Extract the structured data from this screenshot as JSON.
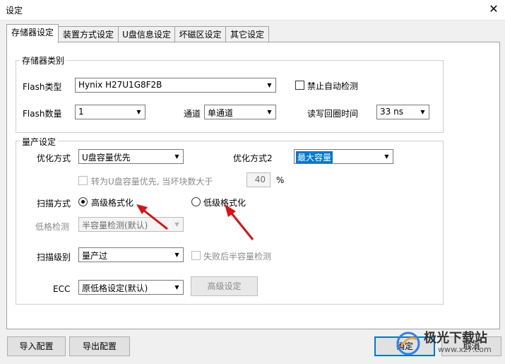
{
  "window": {
    "title": "设定"
  },
  "tabs": [
    {
      "label": "存储器设定",
      "active": true
    },
    {
      "label": "装置方式设定",
      "active": false
    },
    {
      "label": "U盘信息设定",
      "active": false
    },
    {
      "label": "坏磁区设定",
      "active": false
    },
    {
      "label": "其它设定",
      "active": false
    }
  ],
  "storage": {
    "group_title": "存储器类别",
    "flash_type_label": "Flash类型",
    "flash_type_value": "Hynix H27U1G8F2B",
    "disable_auto_detect_label": "禁止自动检测",
    "flash_count_label": "Flash数量",
    "flash_count_value": "1",
    "channel_label": "通道",
    "channel_value": "单通道",
    "rw_timing_label": "读写回圈时间",
    "rw_timing_value": "33 ns"
  },
  "production": {
    "group_title": "量产设定",
    "opt_mode_label": "优化方式",
    "opt_mode_value": "U盘容量优先",
    "opt_mode2_label": "优化方式2",
    "opt_mode2_value": "最大容量",
    "convert_label": "转为U盘容量优先, 当坏块数大于",
    "convert_value": "40",
    "percent": "%",
    "scan_method_label": "扫描方式",
    "high_format_label": "高级格式化",
    "low_format_label": "低级格式化",
    "low_check_label": "低格检测",
    "low_check_value": "半容量检测(默认)",
    "scan_level_label": "扫描级别",
    "scan_level_value": "量产过",
    "half_cap_label": "失败后半容量检测",
    "ecc_label": "ECC",
    "ecc_value": "原低格设定(默认)",
    "advanced_button": "高级设定"
  },
  "footer": {
    "import_button": "导入配置",
    "export_button": "导出配置",
    "ok_button": "确定",
    "cancel_button": "取消"
  },
  "watermark": {
    "text": "极光下载站",
    "url": "www.xz7.com"
  }
}
